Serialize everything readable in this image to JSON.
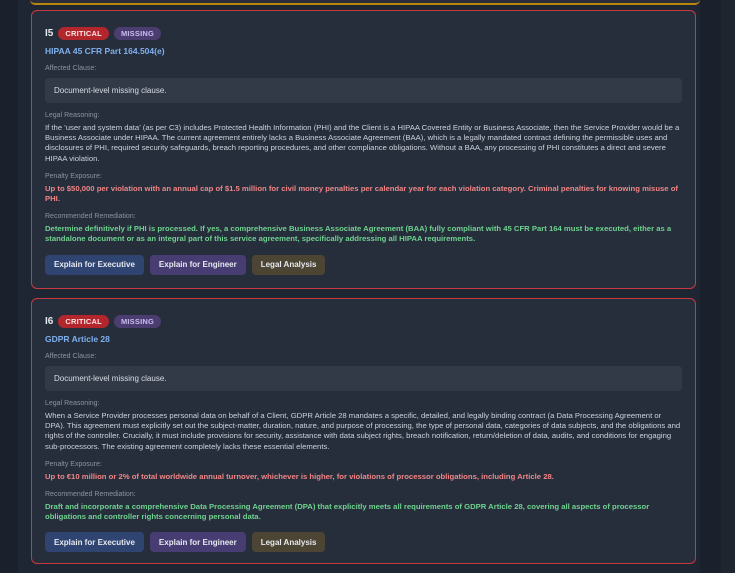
{
  "cards": [
    {
      "id": "I5",
      "severity": "CRITICAL",
      "status": "MISSING",
      "regulation": "HIPAA 45 CFR Part 164.504(e)",
      "affected_label": "Affected Clause:",
      "affected_value": "Document-level missing clause.",
      "reasoning_label": "Legal Reasoning:",
      "reasoning": "If the 'user and system data' (as per C3) includes Protected Health Information (PHI) and the Client is a HIPAA Covered Entity or Business Associate, then the Service Provider would be a Business Associate under HIPAA. The current agreement entirely lacks a Business Associate Agreement (BAA), which is a legally mandated contract defining the permissible uses and disclosures of PHI, required security safeguards, breach reporting procedures, and other compliance obligations. Without a BAA, any processing of PHI constitutes a direct and severe HIPAA violation.",
      "penalty_label": "Penalty Exposure:",
      "penalty": "Up to $50,000 per violation with an annual cap of $1.5 million for civil money penalties per calendar year for each violation category. Criminal penalties for knowing misuse of PHI.",
      "remediation_label": "Recommended Remediation:",
      "remediation": "Determine definitively if PHI is processed. If yes, a comprehensive Business Associate Agreement (BAA) fully compliant with 45 CFR Part 164 must be executed, either as a standalone document or as an integral part of this service agreement, specifically addressing all HIPAA requirements.",
      "buttons": {
        "exec": "Explain for Executive",
        "eng": "Explain for Engineer",
        "legal": "Legal Analysis"
      }
    },
    {
      "id": "I6",
      "severity": "CRITICAL",
      "status": "MISSING",
      "regulation": "GDPR Article 28",
      "affected_label": "Affected Clause:",
      "affected_value": "Document-level missing clause.",
      "reasoning_label": "Legal Reasoning:",
      "reasoning": "When a Service Provider processes personal data on behalf of a Client, GDPR Article 28 mandates a specific, detailed, and legally binding contract (a Data Processing Agreement or DPA). This agreement must explicitly set out the subject-matter, duration, nature, and purpose of processing, the type of personal data, categories of data subjects, and the obligations and rights of the controller. Crucially, it must include provisions for security, assistance with data subject rights, breach notification, return/deletion of data, audits, and conditions for engaging sub-processors. The existing agreement completely lacks these essential elements.",
      "penalty_label": "Penalty Exposure:",
      "penalty": "Up to €10 million or 2% of total worldwide annual turnover, whichever is higher, for violations of processor obligations, including Article 28.",
      "remediation_label": "Recommended Remediation:",
      "remediation": "Draft and incorporate a comprehensive Data Processing Agreement (DPA) that explicitly meets all requirements of GDPR Article 28, covering all aspects of processor obligations and controller rights concerning personal data.",
      "buttons": {
        "exec": "Explain for Executive",
        "eng": "Explain for Engineer",
        "legal": "Legal Analysis"
      }
    }
  ]
}
